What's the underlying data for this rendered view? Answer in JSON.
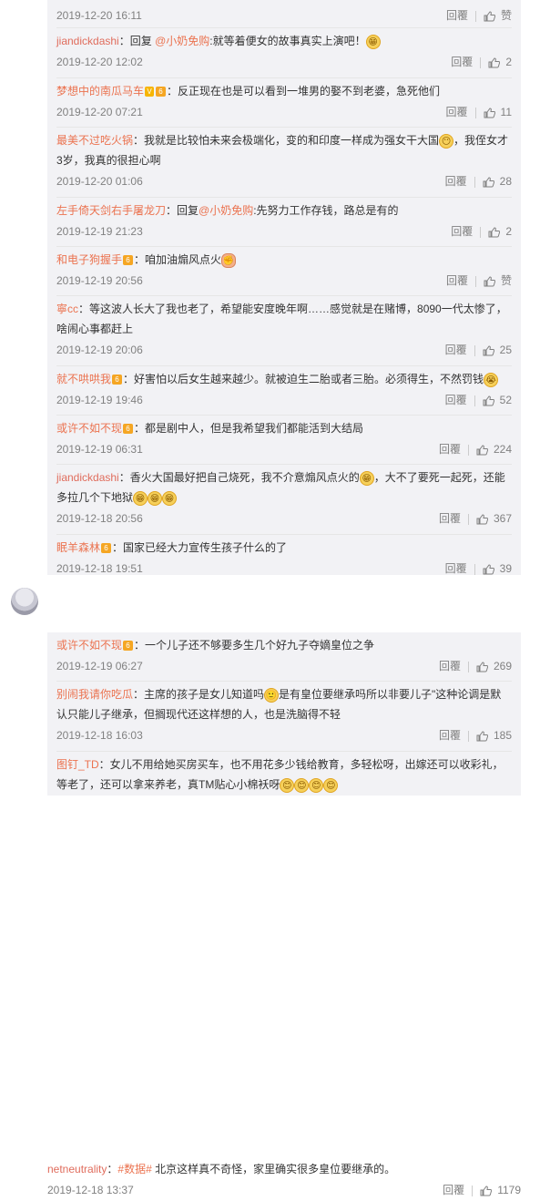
{
  "replies_top": [
    {
      "user": "",
      "text": "",
      "date": "2019-12-20 16:11",
      "like": "赞"
    },
    {
      "user": "jiandickdashi",
      "text": "：回复 ",
      "mention": "@小奶免购",
      "text2": ":就等着便女的故事真实上演吧！",
      "date": "2019-12-20 12:02",
      "like": "2"
    },
    {
      "user": "梦想中的南瓜马车",
      "text": "：反正现在也是可以看到一堆男的娶不到老婆，急死他们",
      "date": "2019-12-20 07:21",
      "like": "11"
    },
    {
      "user": "最美不过吃火锅",
      "text": "：我就是比较怕未来会极端化，变的和印度一样成为强女干大国",
      "text2": "，我侄女才3岁，我真的很担心啊",
      "date": "2019-12-20 01:06",
      "like": "28"
    },
    {
      "user": "左手倚天剑右手屠龙刀",
      "text": "：回复",
      "mention": "@小奶免购",
      "text2": ":先努力工作存钱，路总是有的",
      "date": "2019-12-19 21:23",
      "like": "2"
    },
    {
      "user": "和电子狗握手",
      "text": "：咱加油煽风点火",
      "date": "2019-12-19 20:56",
      "like": "赞"
    },
    {
      "user": "寧cc",
      "text": "：等这波人长大了我也老了，希望能安度晚年啊……感觉就是在赌博，8090一代太惨了，啥闹心事都赶上",
      "date": "2019-12-19 20:06",
      "like": "25"
    },
    {
      "user": "就不哄哄我",
      "text": "：好害怕以后女生越来越少。就被迫生二胎或者三胎。必须得生，不然罚钱",
      "date": "2019-12-19 19:46",
      "like": "52"
    },
    {
      "user": "或许不如不现",
      "text": "：都是剧中人，但是我希望我们都能活到大结局",
      "date": "2019-12-19 06:31",
      "like": "224"
    },
    {
      "user": "jiandickdashi",
      "text": "：香火大国最好把自己烧死，我不介意煽风点火的",
      "text2": "，大不了要死一起死，还能多拉几个下地狱",
      "date": "2019-12-18 20:56",
      "like": "367"
    },
    {
      "user": "眠羊森林",
      "text": "：国家已经大力宣传生孩子什么的了",
      "date": "2019-12-18 19:51",
      "like": "39"
    }
  ],
  "main": {
    "user": "netneutrality",
    "tag": "#数据#",
    "text": " 北京这样真不奇怪，家里确实很多皇位要继承的。",
    "date": "2019-12-18 13:37",
    "like": "1179"
  },
  "replies_bottom": [
    {
      "user": "或许不如不现",
      "text": "：一个儿子还不够要多生几个好九子夺嫡皇位之争",
      "date": "2019-12-19 06:27",
      "like": "269"
    },
    {
      "user": "别闹我请你吃瓜",
      "text": "：主席的孩子是女儿知道吗",
      "text2": "是有皇位要继承吗所以非要儿子\"这种论调是默认只能儿子继承，但搁现代还这样想的人，也是洗脑得不轻",
      "date": "2019-12-18 16:03",
      "like": "185"
    },
    {
      "user": "图钉_TD",
      "text": "：女儿不用给她买房买车，也不用花多少钱给教育，多轻松呀，出嫁还可以收彩礼，等老了，还可以拿来养老，真TM贴心小棉袄呀",
      "date": "",
      "like": ""
    }
  ],
  "labels": {
    "reply": "回覆"
  }
}
